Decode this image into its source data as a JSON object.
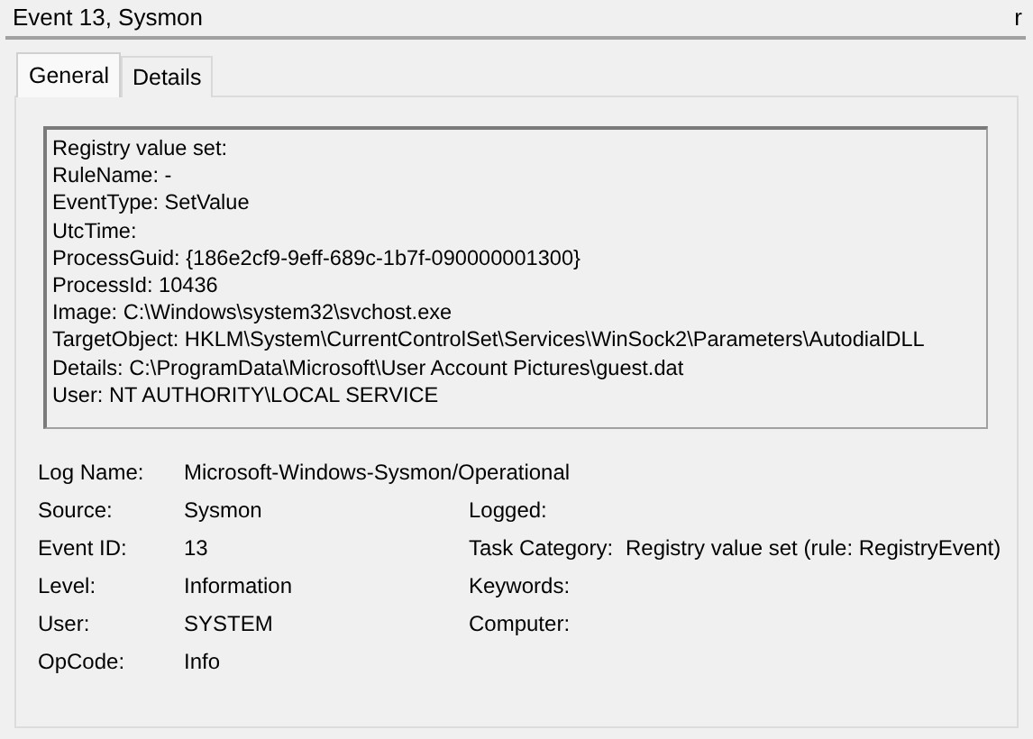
{
  "header": {
    "title": "Event 13, Sysmon",
    "corner": "r"
  },
  "tabs": [
    {
      "label": "General",
      "selected": true
    },
    {
      "label": "Details",
      "selected": false
    }
  ],
  "description": [
    "Registry value set:",
    "RuleName: -",
    "EventType: SetValue",
    "UtcTime:",
    "ProcessGuid: {186e2cf9-9eff-689c-1b7f-090000001300}",
    "ProcessId: 10436",
    "Image: C:\\Windows\\system32\\svchost.exe",
    "TargetObject: HKLM\\System\\CurrentControlSet\\Services\\WinSock2\\Parameters\\AutodialDLL",
    "Details: C:\\ProgramData\\Microsoft\\User Account Pictures\\guest.dat",
    "User: NT AUTHORITY\\LOCAL SERVICE"
  ],
  "properties": [
    {
      "label": "Log Name:",
      "value": "Microsoft-Windows-Sysmon/Operational"
    },
    {
      "label": "Source:",
      "value": "Sysmon",
      "label2": "Logged:"
    },
    {
      "label": "Event ID:",
      "value": "13",
      "label2": "Task Category:",
      "value2": "Registry value set (rule: RegistryEvent)"
    },
    {
      "label": "Level:",
      "value": "Information",
      "label2": "Keywords:"
    },
    {
      "label": "User:",
      "value": "SYSTEM",
      "label2": "Computer:"
    },
    {
      "label": "OpCode:",
      "value": "Info"
    }
  ]
}
